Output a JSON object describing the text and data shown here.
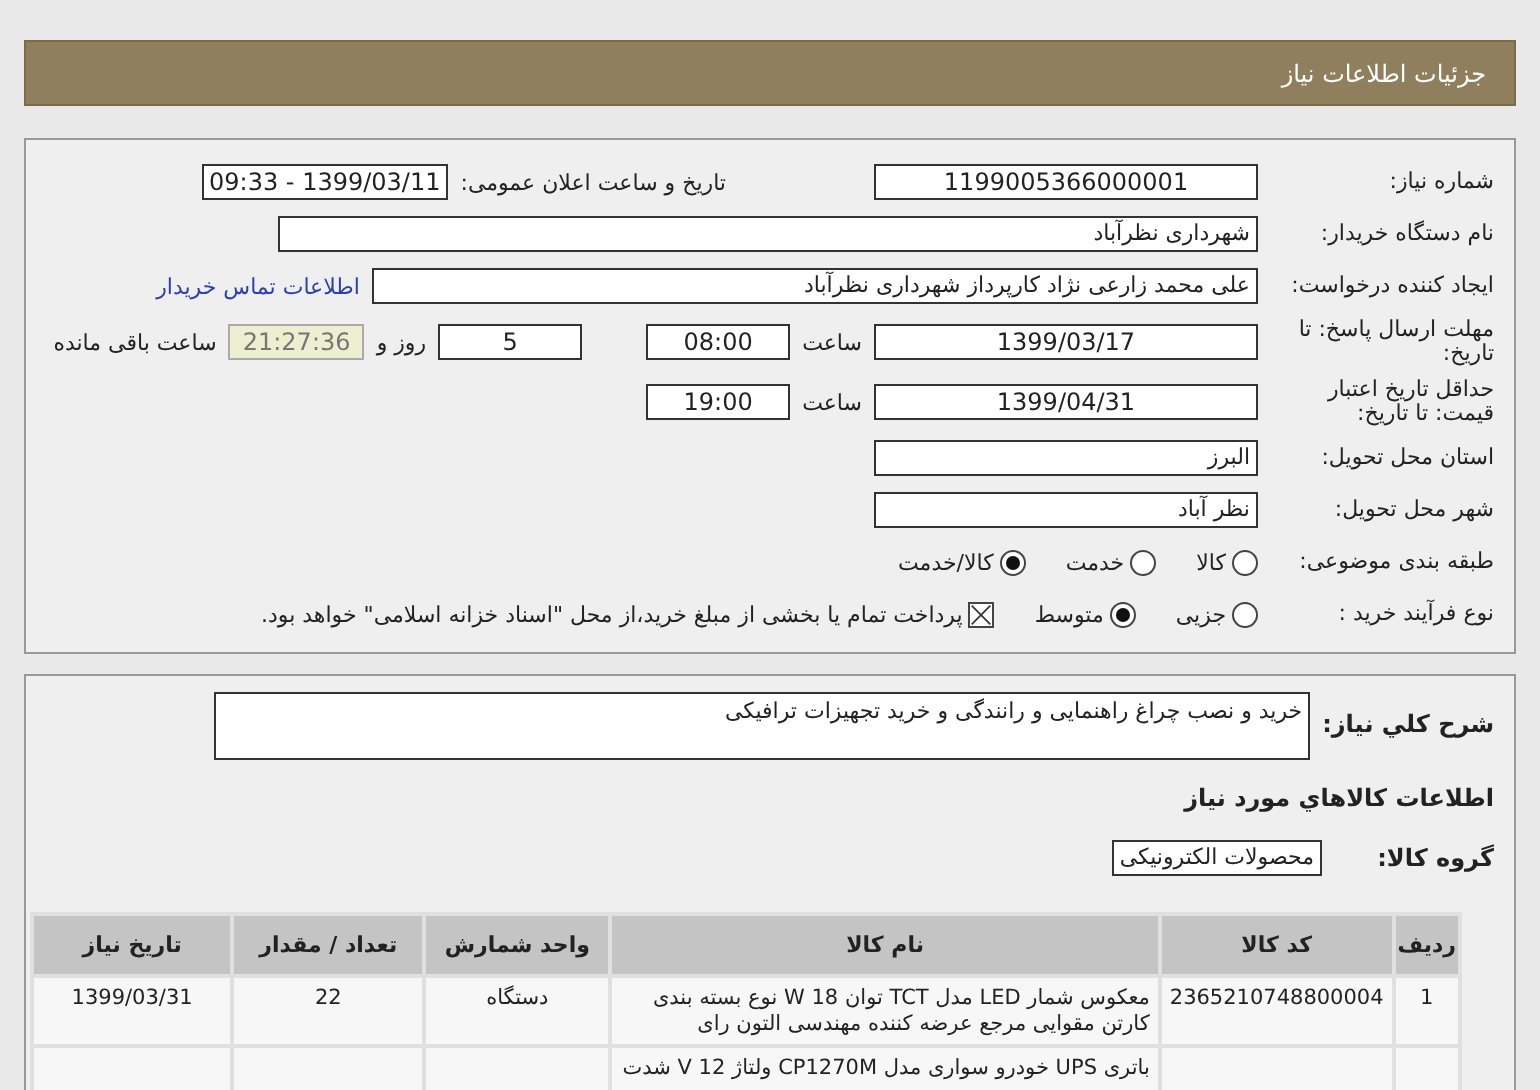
{
  "header": {
    "title": "جزئیات اطلاعات نیاز"
  },
  "need_number": {
    "label": "شماره نیاز:",
    "value": "1199005366000001"
  },
  "announce": {
    "label": "تاریخ و ساعت اعلان عمومی:",
    "value": "1399/03/11 - 09:33"
  },
  "buyer": {
    "label": "نام دستگاه خریدار:",
    "value": "شهرداری نظرآباد"
  },
  "creator": {
    "label": "ایجاد کننده درخواست:",
    "value": "علی محمد زارعی نژاد کارپرداز شهرداری نظرآباد",
    "link": "اطلاعات تماس خریدار"
  },
  "reply_deadline": {
    "label": "مهلت ارسال پاسخ: تا تاریخ:",
    "date": "1399/03/17",
    "time_label": "ساعت",
    "time": "08:00",
    "days": "5",
    "days_label": "روز و",
    "remaining": "21:27:36",
    "remaining_label": "ساعت باقی مانده"
  },
  "price_validity": {
    "label": "حداقل تاریخ اعتبار قیمت: تا تاریخ:",
    "date": "1399/04/31",
    "time_label": "ساعت",
    "time": "19:00"
  },
  "province": {
    "label": "استان محل تحویل:",
    "value": "البرز"
  },
  "city": {
    "label": "شهر محل تحویل:",
    "value": "نظر آباد"
  },
  "category": {
    "label": "طبقه بندی موضوعی:",
    "options": [
      {
        "label": "کالا",
        "selected": false
      },
      {
        "label": "خدمت",
        "selected": false
      },
      {
        "label": "کالا/خدمت",
        "selected": true
      }
    ]
  },
  "process": {
    "label": "نوع فرآیند خرید :",
    "options": [
      {
        "label": "جزیی",
        "selected": false
      },
      {
        "label": "متوسط",
        "selected": true
      }
    ],
    "treasury": {
      "label": "پرداخت تمام یا بخشی از مبلغ خرید،از محل \"اسناد خزانه اسلامی\" خواهد بود.",
      "checked": true
    }
  },
  "description": {
    "label": "شرح کلي نياز:",
    "value": "خرید و نصب چراغ راهنمایی و رانندگی و خرید تجهیزات ترافیکی"
  },
  "items_heading": "اطلاعات کالاهاي مورد نياز",
  "group": {
    "label": "گروه کالا:",
    "value": "محصولات الکترونیکی"
  },
  "table": {
    "columns": [
      "ردیف",
      "کد کالا",
      "نام کالا",
      "واحد شمارش",
      "تعداد / مقدار",
      "تاریخ نیاز"
    ],
    "rows": [
      {
        "row": "1",
        "code": "2365210748800004",
        "name": "معکوس شمار LED مدل TCT توان 18 W نوع بسته بندی کارتن مقوایی مرجع عرضه کننده مهندسی التون رای",
        "unit": "دستگاه",
        "qty": "22",
        "date": "1399/03/31"
      },
      {
        "name": "باتری UPS خودرو سواری مدل CP1270M ولتاژ 12 V شدت"
      }
    ]
  }
}
